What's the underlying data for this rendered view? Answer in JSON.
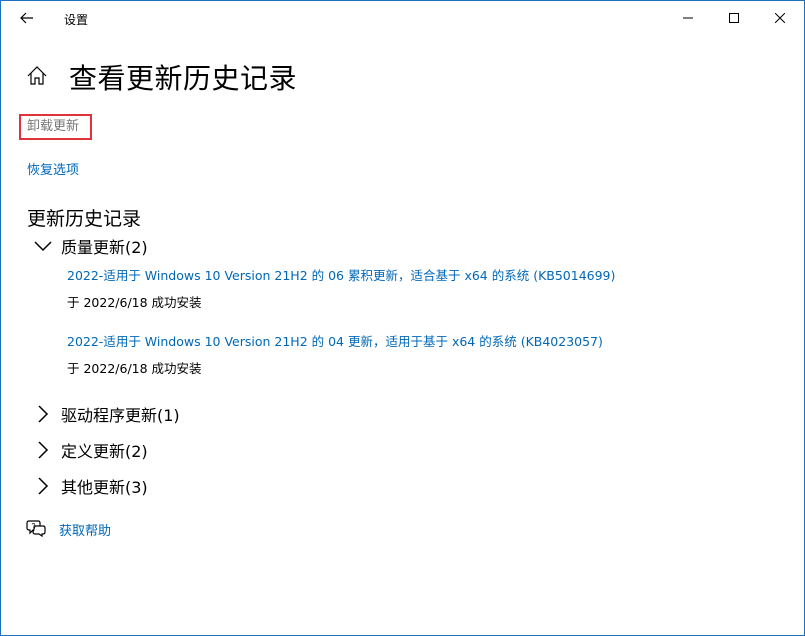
{
  "window": {
    "title": "设置",
    "back_icon": "back-arrow-icon",
    "controls": [
      "minimize-icon",
      "maximize-icon",
      "close-icon"
    ]
  },
  "page": {
    "title": "查看更新历史记录",
    "home_icon": "home-icon"
  },
  "actions": {
    "uninstall": "卸载更新",
    "recovery": "恢复选项"
  },
  "history": {
    "title": "更新历史记录",
    "groups": [
      {
        "label": "质量更新(2)",
        "expanded": true,
        "items": [
          {
            "title": "2022-适用于 Windows 10 Version 21H2 的 06 累积更新，适合基于 x64 的系统 (KB5014699)",
            "status": "于 2022/6/18 成功安装"
          },
          {
            "title": "2022-适用于 Windows 10 Version 21H2 的 04 更新，适用于基于 x64 的系统 (KB4023057)",
            "status": "于 2022/6/18 成功安装"
          }
        ]
      },
      {
        "label": "驱动程序更新(1)",
        "expanded": false
      },
      {
        "label": "定义更新(2)",
        "expanded": false
      },
      {
        "label": "其他更新(3)",
        "expanded": false
      }
    ]
  },
  "help": {
    "label": "获取帮助",
    "icon": "help-chat-icon"
  },
  "colors": {
    "link": "#0067b8",
    "highlight_border": "#e0323a",
    "window_border": "#1f6fbf"
  }
}
